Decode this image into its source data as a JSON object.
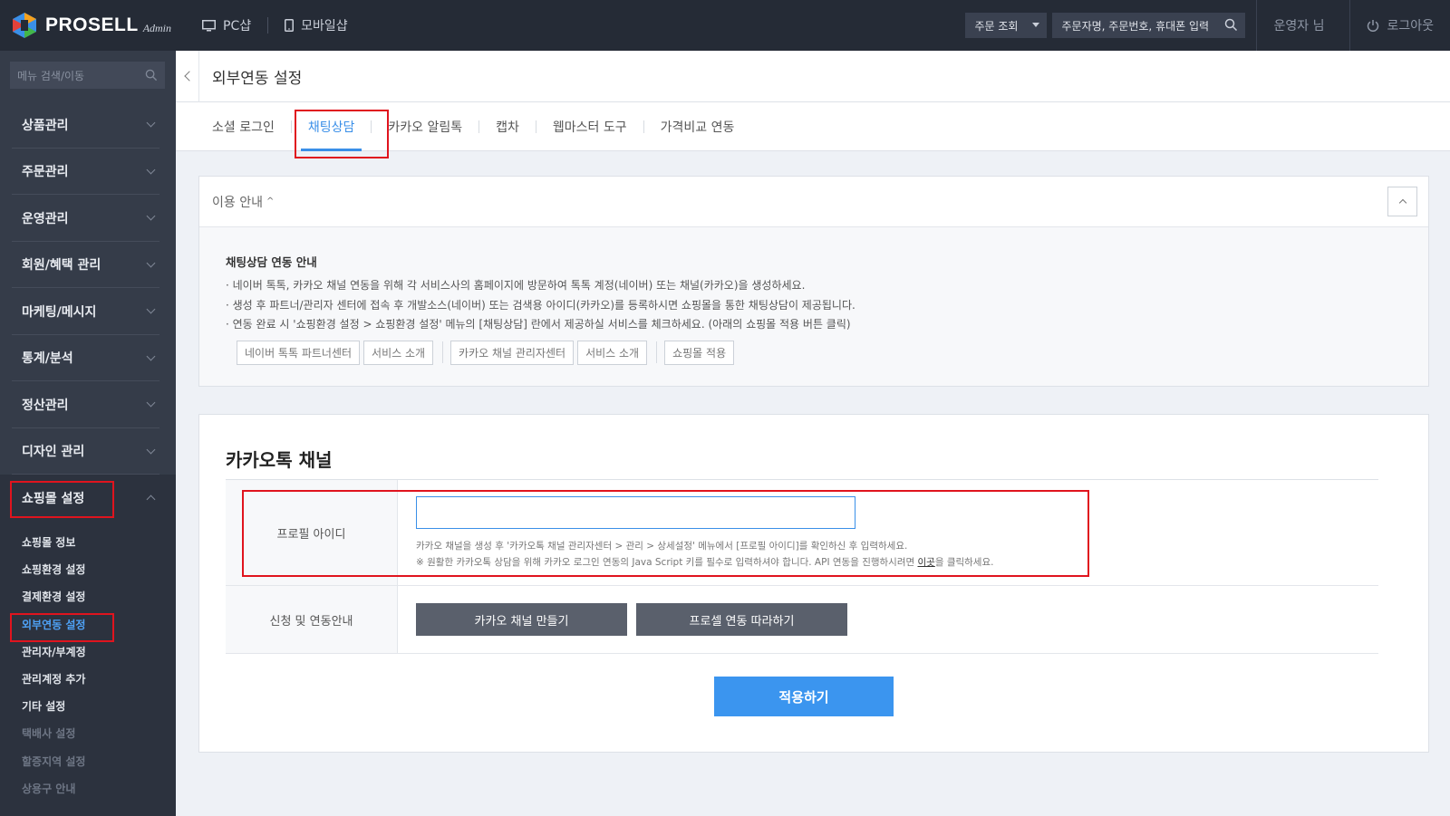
{
  "header": {
    "logo_text": "PROSELL",
    "logo_sub": "Admin",
    "pc_shop": "PC샵",
    "mobile_shop": "모바일샵",
    "order_select": "주문 조회",
    "order_search_placeholder": "주문자명, 주문번호, 휴대폰 입력",
    "operator": "운영자 님",
    "logout": "로그아웃"
  },
  "sidebar": {
    "search_placeholder": "메뉴 검색/이동",
    "menu": [
      {
        "label": "상품관리"
      },
      {
        "label": "주문관리"
      },
      {
        "label": "운영관리"
      },
      {
        "label": "회원/혜택 관리"
      },
      {
        "label": "마케팅/메시지"
      },
      {
        "label": "통계/분석"
      },
      {
        "label": "정산관리"
      },
      {
        "label": "디자인 관리"
      },
      {
        "label": "쇼핑몰 설정"
      }
    ],
    "submenu": [
      {
        "label": "쇼핑몰 정보"
      },
      {
        "label": "쇼핑환경 설정"
      },
      {
        "label": "결제환경 설정"
      },
      {
        "label": "외부연동 설정"
      },
      {
        "label": "관리자/부계정"
      },
      {
        "label": "관리계정 추가"
      },
      {
        "label": "기타 설정"
      },
      {
        "label": "택배사 설정"
      },
      {
        "label": "할증지역 설정"
      },
      {
        "label": "상용구 안내"
      }
    ]
  },
  "page": {
    "title": "외부연동 설정",
    "tabs": [
      {
        "label": "소셜 로그인"
      },
      {
        "label": "채팅상담"
      },
      {
        "label": "카카오 알림톡"
      },
      {
        "label": "캡차"
      },
      {
        "label": "웹마스터 도구"
      },
      {
        "label": "가격비교 연동"
      }
    ]
  },
  "guide": {
    "header": "이용 안내",
    "title": "채팅상담 연동 안내",
    "lines": [
      "· 네이버 톡톡, 카카오 채널 연동을 위해 각 서비스사의 홈페이지에 방문하여 톡톡 계정(네이버) 또는 채널(카카오)을 생성하세요.",
      "· 생성 후 파트너/관리자 센터에 접속 후 개발소스(네이버) 또는 검색용 아이디(카카오)를 등록하시면 쇼핑몰을 통한 채팅상담이 제공됩니다.",
      "· 연동 완료 시 '쇼핑환경 설정 > 쇼핑환경 설정' 메뉴의 [채팅상담] 란에서 제공하실 서비스를 체크하세요. (아래의 쇼핑몰 적용 버튼 클릭)"
    ],
    "buttons": {
      "naver_partner": "네이버 톡톡 파트너센터",
      "naver_intro": "서비스 소개",
      "kakao_admin": "카카오 채널 관리자센터",
      "kakao_intro": "서비스 소개",
      "apply_shop": "쇼핑몰 적용"
    }
  },
  "kakao": {
    "section_title": "카카오톡 채널",
    "profile_label": "프로필 아이디",
    "profile_value": "",
    "help1": "카카오 채널을 생성 후 '카카오톡 채널 관리자센터 > 관리 > 상세설정' 메뉴에서 [프로필 아이디]를 확인하신 후 입력하세요.",
    "help2_pre": "※ 원활한 카카오톡 상담을 위해 카카오 로그인 연동의 Java Script 키를 필수로 입력하셔야 합니다. API 연동을 진행하시려면 ",
    "help2_link": "이곳",
    "help2_post": "을 클릭하세요.",
    "guide_label": "신청 및 연동안내",
    "create_channel": "카카오 채널 만들기",
    "prosell_follow": "프로셀 연동 따라하기",
    "apply": "적용하기"
  },
  "colors": {
    "topbar": "#252b36",
    "sidebar": "#353c49",
    "accent": "#3b95ef",
    "highlight": "#e0141e"
  }
}
